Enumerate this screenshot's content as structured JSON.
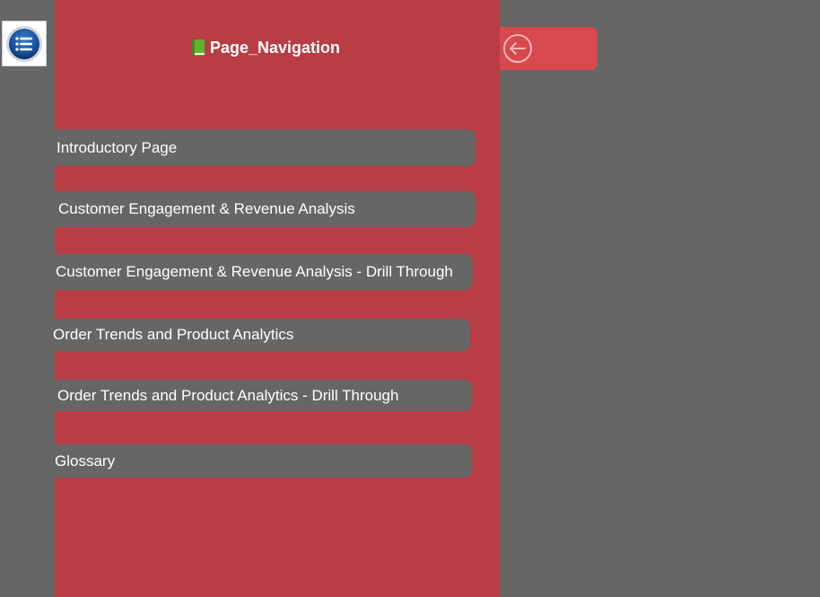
{
  "menu_button": {
    "icon": "hamburger-menu-icon"
  },
  "panel": {
    "title": "Page_Navigation",
    "title_icon": "green-book-icon",
    "background": "#b83d44",
    "items": [
      {
        "label": "Introductory Page"
      },
      {
        "label": "Customer Engagement & Revenue Analysis"
      },
      {
        "label": "Customer Engagement & Revenue Analysis - Drill Through"
      },
      {
        "label": "Order Trends and Product Analytics"
      },
      {
        "label": "Order Trends and Product Analytics - Drill Through"
      },
      {
        "label": "Glossary"
      }
    ]
  },
  "back_button": {
    "icon": "back-arrow-circle-icon",
    "background": "#d9484f"
  },
  "canvas_background": "#666666"
}
